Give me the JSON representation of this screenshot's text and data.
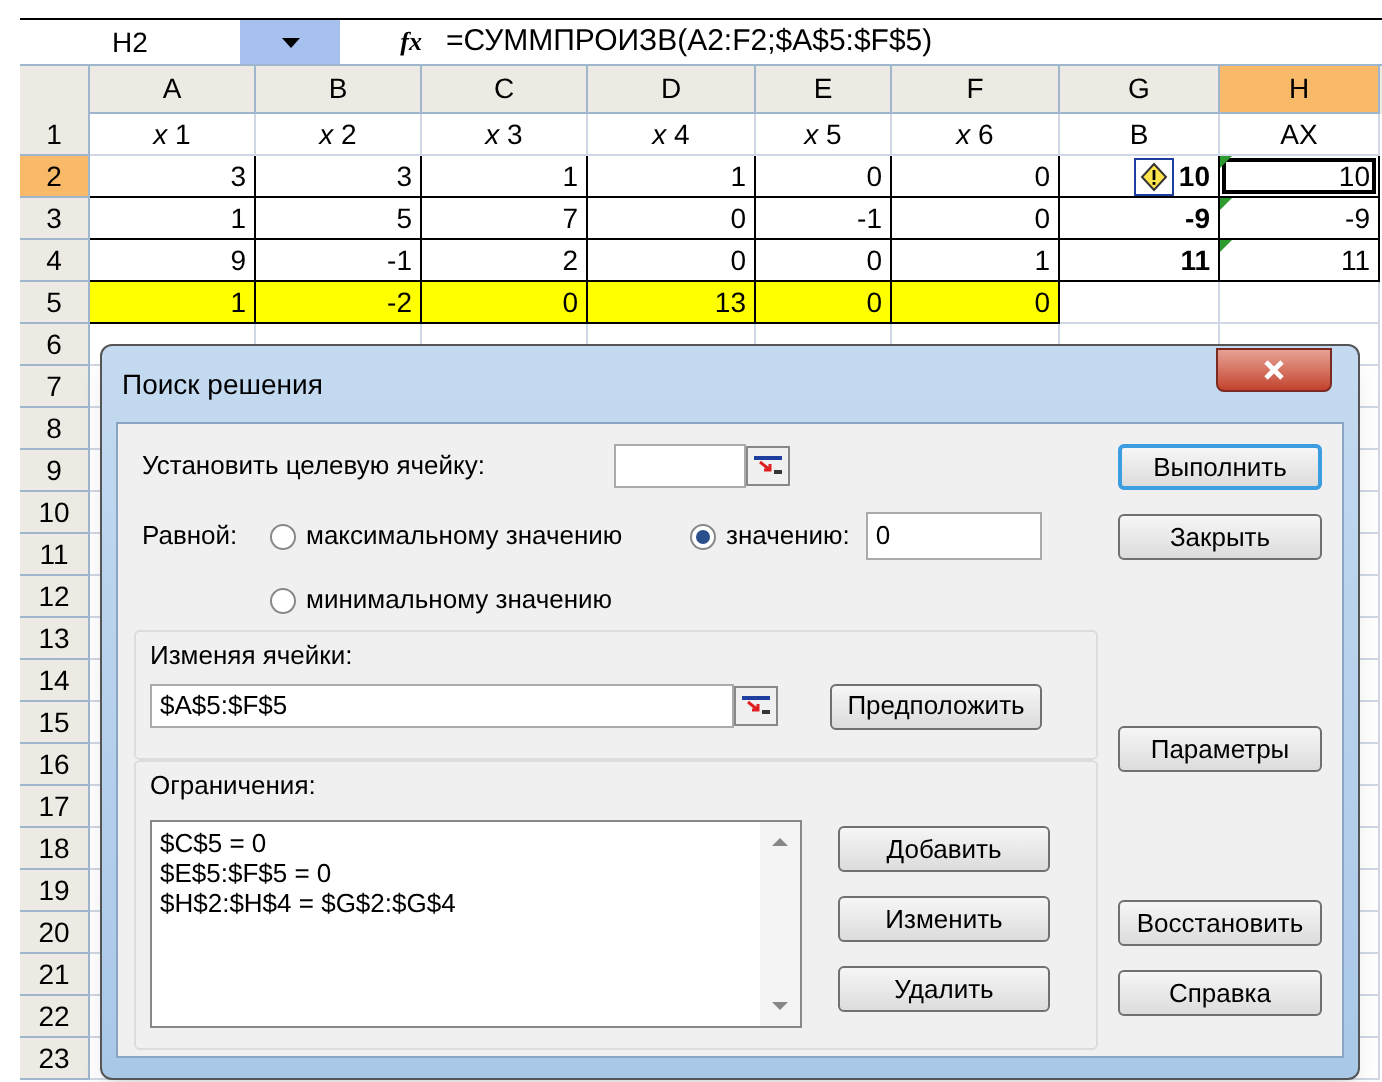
{
  "formula_bar": {
    "name_box": "H2",
    "function_label": "fx",
    "formula": "=СУММПРОИЗВ(A2:F2;$A$5:$F$5)"
  },
  "columns": [
    {
      "label": "A",
      "selected": false
    },
    {
      "label": "B",
      "selected": false
    },
    {
      "label": "C",
      "selected": false
    },
    {
      "label": "D",
      "selected": false
    },
    {
      "label": "E",
      "selected": false
    },
    {
      "label": "F",
      "selected": false
    },
    {
      "label": "G",
      "selected": false
    },
    {
      "label": "H",
      "selected": true
    }
  ],
  "rows": [
    {
      "header": "1",
      "selected": false,
      "cells": [
        {
          "text": "*x* 1",
          "kind": "label"
        },
        {
          "text": "*x* 2",
          "kind": "label"
        },
        {
          "text": "*x* 3",
          "kind": "label"
        },
        {
          "text": "*x* 4",
          "kind": "label"
        },
        {
          "text": "*x* 5",
          "kind": "label"
        },
        {
          "text": "*x* 6",
          "kind": "label"
        },
        {
          "text": "B",
          "kind": "label"
        },
        {
          "text": "AX",
          "kind": "label"
        }
      ]
    },
    {
      "header": "2",
      "selected": true,
      "cells": [
        {
          "text": "3",
          "kind": "number"
        },
        {
          "text": "3",
          "kind": "number"
        },
        {
          "text": "1",
          "kind": "number"
        },
        {
          "text": "1",
          "kind": "number"
        },
        {
          "text": "0",
          "kind": "number"
        },
        {
          "text": "0",
          "kind": "number"
        },
        {
          "text": "10",
          "kind": "total",
          "warning": true
        },
        {
          "text": "10",
          "kind": "number",
          "flagged": true,
          "active": true
        }
      ]
    },
    {
      "header": "3",
      "selected": false,
      "cells": [
        {
          "text": "1",
          "kind": "number"
        },
        {
          "text": "5",
          "kind": "number"
        },
        {
          "text": "7",
          "kind": "number"
        },
        {
          "text": "0",
          "kind": "number"
        },
        {
          "text": "-1",
          "kind": "number"
        },
        {
          "text": "0",
          "kind": "number"
        },
        {
          "text": "-9",
          "kind": "total"
        },
        {
          "text": "-9",
          "kind": "number",
          "flagged": true
        }
      ]
    },
    {
      "header": "4",
      "selected": false,
      "cells": [
        {
          "text": "9",
          "kind": "number"
        },
        {
          "text": "-1",
          "kind": "number"
        },
        {
          "text": "2",
          "kind": "number"
        },
        {
          "text": "0",
          "kind": "number"
        },
        {
          "text": "0",
          "kind": "number"
        },
        {
          "text": "1",
          "kind": "number"
        },
        {
          "text": "11",
          "kind": "total"
        },
        {
          "text": "11",
          "kind": "number",
          "flagged": true
        }
      ]
    },
    {
      "header": "5",
      "selected": false,
      "cells": [
        {
          "text": "1",
          "kind": "number",
          "highlighted": true
        },
        {
          "text": "-2",
          "kind": "number",
          "highlighted": true
        },
        {
          "text": "0",
          "kind": "number",
          "highlighted": true
        },
        {
          "text": "13",
          "kind": "number",
          "highlighted": true
        },
        {
          "text": "0",
          "kind": "number",
          "highlighted": true
        },
        {
          "text": "0",
          "kind": "number",
          "highlighted": true
        },
        {
          "kind": "empty"
        },
        {
          "kind": "empty"
        }
      ]
    },
    {
      "header": "6",
      "selected": false,
      "cells": []
    },
    {
      "header": "7",
      "selected": false,
      "cells": []
    },
    {
      "header": "8",
      "selected": false,
      "cells": []
    },
    {
      "header": "9",
      "selected": false,
      "cells": []
    },
    {
      "header": "10",
      "selected": false,
      "cells": []
    },
    {
      "header": "11",
      "selected": false,
      "cells": []
    },
    {
      "header": "12",
      "selected": false,
      "cells": []
    },
    {
      "header": "13",
      "selected": false,
      "cells": []
    },
    {
      "header": "14",
      "selected": false,
      "cells": []
    },
    {
      "header": "15",
      "selected": false,
      "cells": []
    },
    {
      "header": "16",
      "selected": false,
      "cells": []
    },
    {
      "header": "17",
      "selected": false,
      "cells": []
    },
    {
      "header": "18",
      "selected": false,
      "cells": []
    },
    {
      "header": "19",
      "selected": false,
      "cells": []
    },
    {
      "header": "20",
      "selected": false,
      "cells": []
    },
    {
      "header": "21",
      "selected": false,
      "cells": []
    },
    {
      "header": "22",
      "selected": false,
      "cells": []
    },
    {
      "header": "23",
      "selected": false,
      "cells": []
    }
  ],
  "dialog": {
    "title": "Поиск решения",
    "target_label": "Установить целевую ячейку:",
    "equal_label": "Равной:",
    "options": [
      {
        "label": "максимальному значению",
        "selected": false
      },
      {
        "label": "значению:",
        "selected": true
      },
      {
        "label": "минимальному значению",
        "selected": false
      }
    ],
    "value": "0",
    "changing_label": "Изменяя ячейки:",
    "changing_value": "$A$5:$F$5",
    "guess_button": "Предположить",
    "constraints_label": "Ограничения:",
    "constraints": [
      "$C$5 = 0",
      "$E$5:$F$5 = 0",
      "$H$2:$H$4 = $G$2:$G$4"
    ],
    "constraint_buttons": [
      "Добавить",
      "Изменить",
      "Удалить"
    ],
    "side_buttons": [
      {
        "label": "Выполнить",
        "default": true
      },
      {
        "label": "Закрыть",
        "default": false
      },
      {
        "label": "Параметры",
        "default": false
      },
      {
        "label": "Восстановить",
        "default": false
      },
      {
        "label": "Справка",
        "default": false
      }
    ]
  }
}
